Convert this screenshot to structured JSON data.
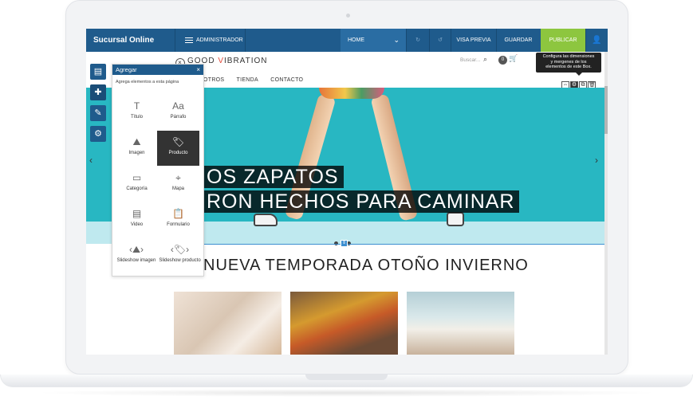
{
  "editor": {
    "brand": "Sucursal Online",
    "admin": "ADMINISTRADOR",
    "page": "HOME",
    "preview": "VISA PREVIA",
    "save": "GUARDAR",
    "publish": "PUBLICAR"
  },
  "site": {
    "logo_pre": "GOOD ",
    "logo_v": "V",
    "logo_post": "IBRATION",
    "search_placeholder": "Buscar...",
    "cart_count": "0",
    "nav": [
      "OTROS",
      "TIENDA",
      "CONTACTO"
    ],
    "hero_line1": "OS ZAPATOS",
    "hero_line2": "RON HECHOS PARA CAMINAR",
    "season_title": "NUEVA TEMPORADA OTOÑO INVIERNO"
  },
  "tooltip": {
    "line1": "Configura las dimensiones",
    "line2": "y mergenes de los",
    "line3": "elementos de este Box."
  },
  "panel": {
    "title": "Agregar",
    "subtitle": "Agrega elementos a esta página",
    "items": [
      {
        "label": "Título",
        "icon": "T"
      },
      {
        "label": "Párrafo",
        "icon": "Aa"
      },
      {
        "label": "Imagen",
        "icon": "⛰"
      },
      {
        "label": "Producto",
        "icon": "🏷"
      },
      {
        "label": "Categoría",
        "icon": "▭"
      },
      {
        "label": "Mapa",
        "icon": "⌖"
      },
      {
        "label": "Video",
        "icon": "▤"
      },
      {
        "label": "Formulario",
        "icon": "📋"
      },
      {
        "label": "Slideshow imagen",
        "icon": "‹⛰›"
      },
      {
        "label": "Slideshow producto",
        "icon": "‹🏷›"
      }
    ]
  },
  "colors": {
    "topbar": "#1f5b8c",
    "publish": "#8dc63f",
    "hero_bg": "#28b7c2"
  }
}
